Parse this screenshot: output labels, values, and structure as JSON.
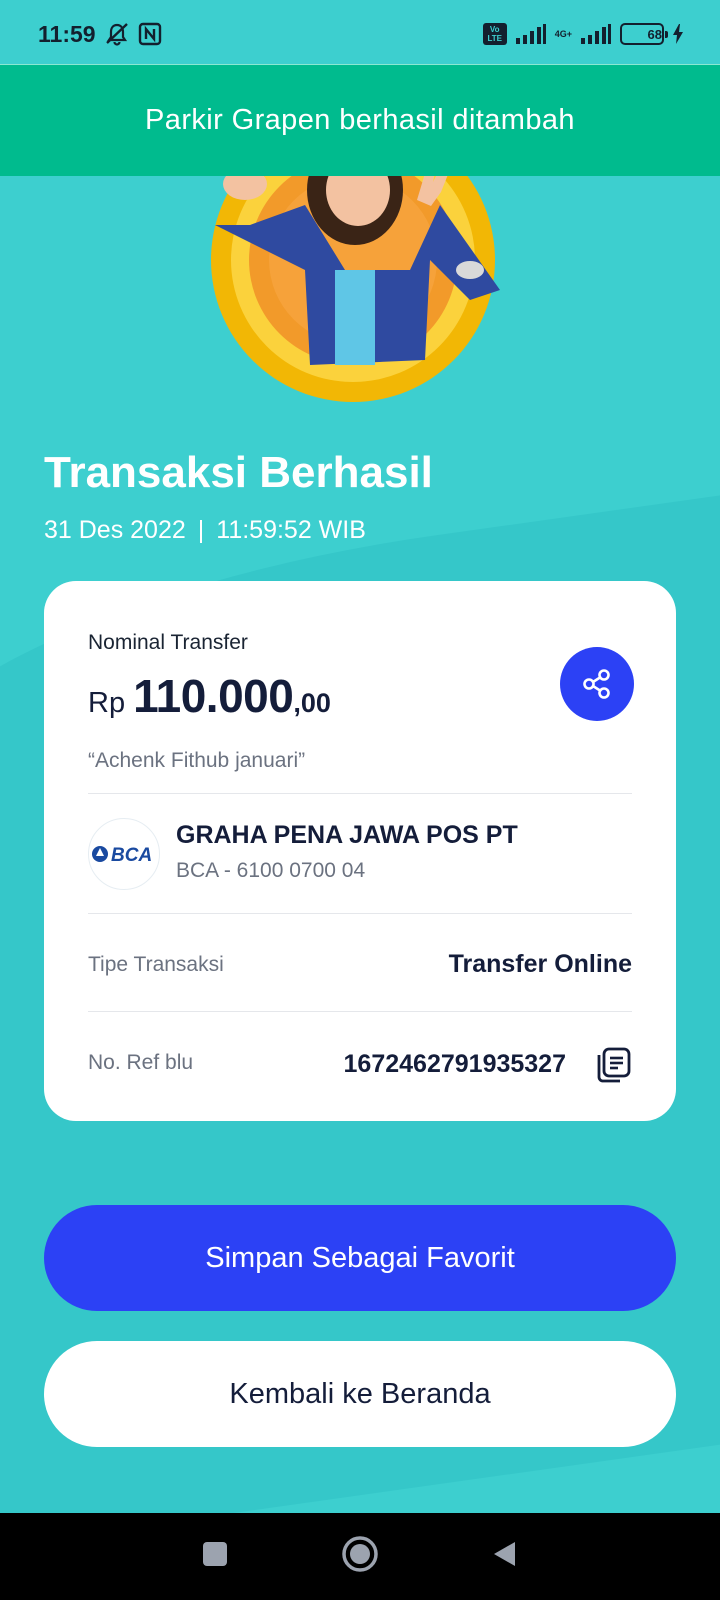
{
  "status_bar": {
    "time": "11:59",
    "volte_label": "Vo LTE",
    "network_label": "4G+",
    "battery_level": "68"
  },
  "toast": {
    "message": "Parkir Grapen berhasil ditambah"
  },
  "result": {
    "title": "Transaksi Berhasil",
    "date": "31 Des 2022",
    "separator": "|",
    "time": "11:59:52 WIB"
  },
  "card": {
    "amount_label": "Nominal Transfer",
    "currency": "Rp",
    "amount_main": "110.000",
    "amount_decimal": ",00",
    "note": "“Achenk Fithub januari”",
    "recipient": {
      "bank_logo_text": "BCA",
      "name": "GRAHA PENA JAWA POS PT",
      "account": "BCA - 6100 0700 04"
    },
    "type_label": "Tipe Transaksi",
    "type_value": "Transfer Online",
    "ref_label": "No. Ref blu",
    "ref_value": "1672462791935327"
  },
  "buttons": {
    "primary": "Simpan Sebagai Favorit",
    "secondary": "Kembali ke Beranda"
  },
  "colors": {
    "background": "#3dcfcf",
    "toast": "#00bb8e",
    "accent": "#2c41f5",
    "text_dark": "#141d3a"
  },
  "icons": {
    "share": "share-icon",
    "copy": "copy-icon",
    "nav": [
      "recents-icon",
      "home-icon",
      "back-icon"
    ]
  }
}
